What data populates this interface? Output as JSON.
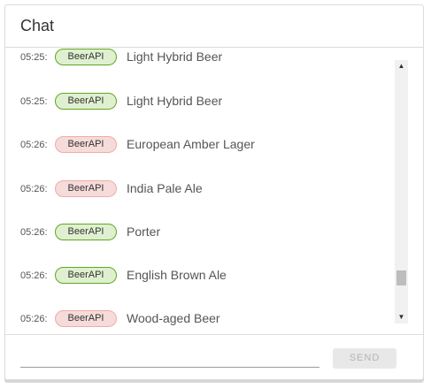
{
  "header": {
    "title": "Chat"
  },
  "messages": [
    {
      "time": "05:25:",
      "source": "BeerAPI",
      "status": "ok",
      "text": "Light Hybrid Beer"
    },
    {
      "time": "05:25:",
      "source": "BeerAPI",
      "status": "ok",
      "text": "Light Hybrid Beer"
    },
    {
      "time": "05:26:",
      "source": "BeerAPI",
      "status": "error",
      "text": "European Amber Lager"
    },
    {
      "time": "05:26:",
      "source": "BeerAPI",
      "status": "error",
      "text": "India Pale Ale"
    },
    {
      "time": "05:26:",
      "source": "BeerAPI",
      "status": "ok",
      "text": "Porter"
    },
    {
      "time": "05:26:",
      "source": "BeerAPI",
      "status": "ok",
      "text": "English Brown Ale"
    },
    {
      "time": "05:26:",
      "source": "BeerAPI",
      "status": "error",
      "text": "Wood-aged Beer"
    }
  ],
  "scrollbar": {
    "up_icon": "triangle-up",
    "down_icon": "triangle-down"
  },
  "composer": {
    "input_value": "",
    "send_label": "SEND",
    "send_enabled": false
  },
  "colors": {
    "ok_bg": "#dff0d0",
    "ok_border": "#62a420",
    "error_bg": "#f5dbd9",
    "error_border": "#f0aca6"
  }
}
